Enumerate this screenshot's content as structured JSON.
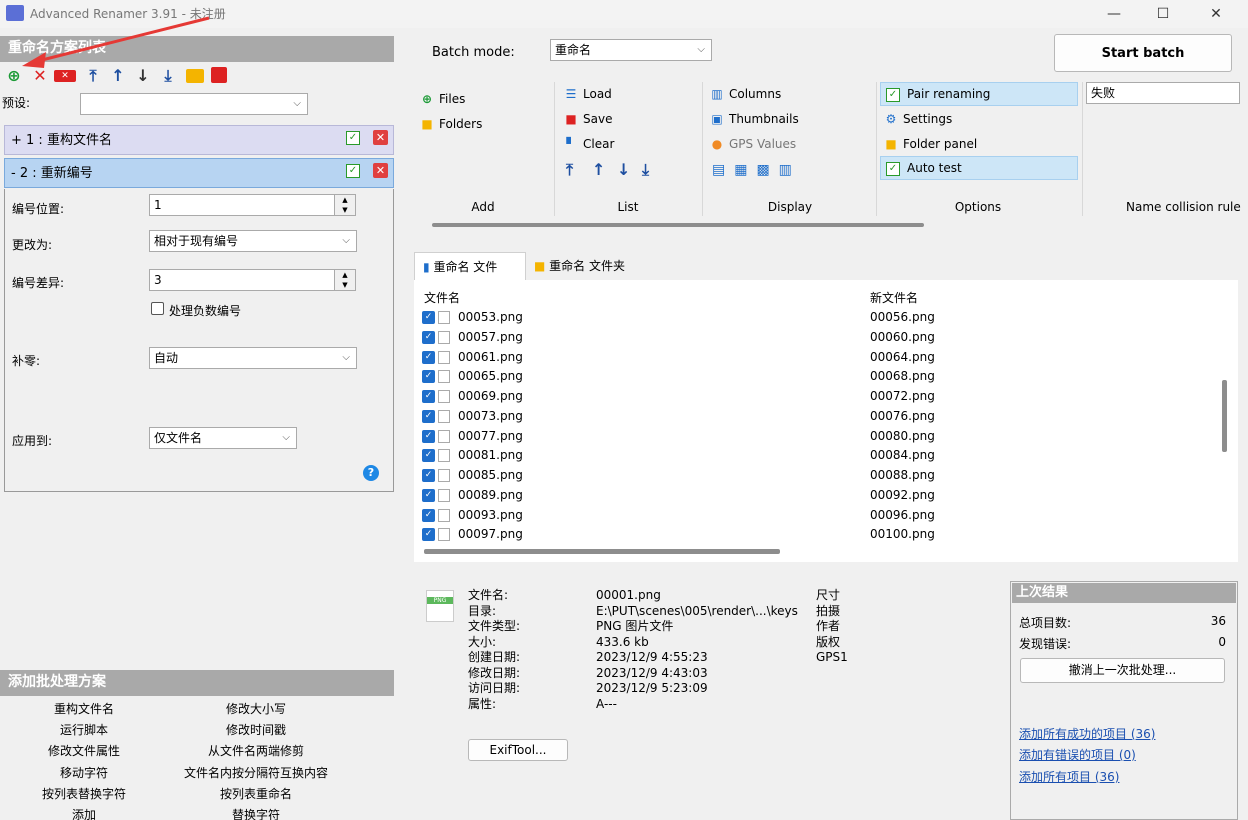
{
  "window": {
    "title": "Advanced Renamer 3.91 - 未注册",
    "minimize": "—",
    "maximize": "☐",
    "close": "✕"
  },
  "methods": {
    "title": "重命名方案列表",
    "preset_label": "预设:",
    "preset_value": "",
    "items": [
      {
        "label": "+ 1 : 重构文件名"
      },
      {
        "label": "- 2 : 重新编号"
      }
    ],
    "fields": {
      "pos_label": "编号位置:",
      "pos_value": "1",
      "change_label": "更改为:",
      "change_value": "相对于现有编号",
      "diff_label": "编号差异:",
      "diff_value": "3",
      "neg_label": "处理负数编号",
      "pad_label": "补零:",
      "pad_value": "自动",
      "apply_label": "应用到:",
      "apply_value": "仅文件名"
    },
    "help": "?"
  },
  "add_methods": {
    "title": "添加批处理方案",
    "items": [
      "重构文件名",
      "修改大小写",
      "运行脚本",
      "修改时间戳",
      "修改文件属性",
      "从文件名两端修剪",
      "移动字符",
      "文件名内按分隔符互换内容",
      "按列表替换字符",
      "按列表重命名",
      "添加",
      "替换字符"
    ]
  },
  "toolbar": {
    "batch_mode_label": "Batch mode:",
    "batch_mode_value": "重命名",
    "start_batch": "Start batch"
  },
  "ribbon": {
    "add": {
      "files": "Files",
      "folders": "Folders",
      "label": "Add"
    },
    "list": {
      "load": "Load",
      "save": "Save",
      "clear": "Clear",
      "label": "List"
    },
    "display": {
      "columns": "Columns",
      "thumbnails": "Thumbnails",
      "gps": "GPS Values",
      "label": "Display"
    },
    "options": {
      "pair": "Pair renaming",
      "settings": "Settings",
      "folder_panel": "Folder panel",
      "auto_test": "Auto test",
      "label": "Options"
    },
    "collision": {
      "value": "失败",
      "label": "Name collision rule"
    }
  },
  "tabs": [
    {
      "label": "重命名 文件"
    },
    {
      "label": "重命名 文件夹"
    }
  ],
  "file_list": {
    "headers": [
      "文件名",
      "新文件名"
    ],
    "rows": [
      {
        "name": "00053.png",
        "new": "00056.png"
      },
      {
        "name": "00057.png",
        "new": "00060.png"
      },
      {
        "name": "00061.png",
        "new": "00064.png"
      },
      {
        "name": "00065.png",
        "new": "00068.png"
      },
      {
        "name": "00069.png",
        "new": "00072.png"
      },
      {
        "name": "00073.png",
        "new": "00076.png"
      },
      {
        "name": "00077.png",
        "new": "00080.png"
      },
      {
        "name": "00081.png",
        "new": "00084.png"
      },
      {
        "name": "00085.png",
        "new": "00088.png"
      },
      {
        "name": "00089.png",
        "new": "00092.png"
      },
      {
        "name": "00093.png",
        "new": "00096.png"
      },
      {
        "name": "00097.png",
        "new": "00100.png"
      }
    ]
  },
  "file_info": {
    "labels": [
      "文件名:",
      "目录:",
      "文件类型:",
      "大小:",
      "创建日期:",
      "修改日期:",
      "访问日期:",
      "属性:"
    ],
    "values": [
      "00001.png",
      "E:\\PUT\\scenes\\005\\render\\...\\keys",
      "PNG 图片文件",
      "433.6 kb",
      "2023/12/9 4:55:23",
      "2023/12/9 4:43:03",
      "2023/12/9 5:23:09",
      "A---"
    ],
    "extra": [
      "尺寸",
      "拍摄",
      "作者",
      "版权",
      "GPS1"
    ],
    "exif_button": "ExifTool...",
    "icon_text": "PNG"
  },
  "last_result": {
    "title": "上次结果",
    "total_label": "总项目数:",
    "total_value": "36",
    "errors_label": "发现错误:",
    "errors_value": "0",
    "undo": "撤消上一次批处理...",
    "links": [
      "添加所有成功的项目 (36)",
      "添加有错误的项目 (0)",
      "添加所有项目 (36)"
    ]
  },
  "colors": {
    "accent": "#1e6ecb",
    "header_bg": "#a9a9a9",
    "highlight": "#cde6f7",
    "annotation": "#e53935"
  }
}
